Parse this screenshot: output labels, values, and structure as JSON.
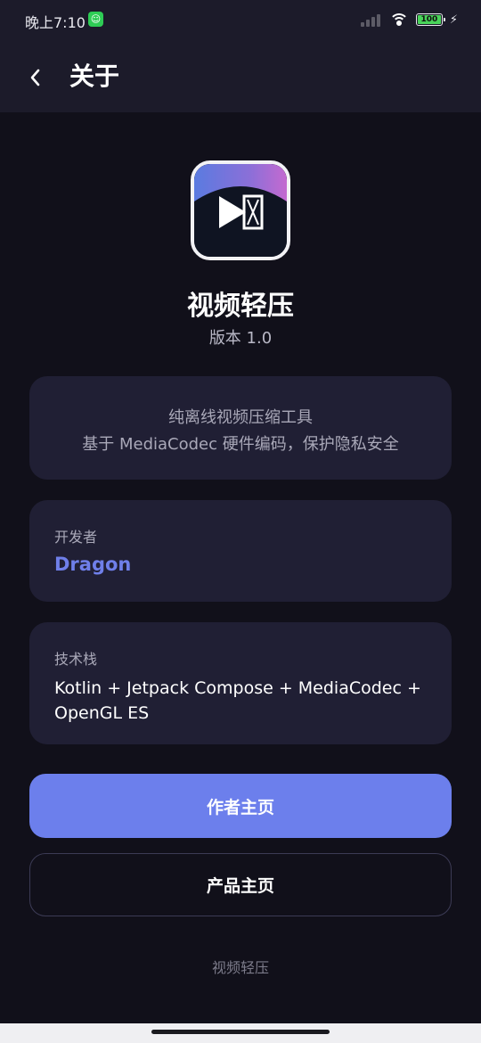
{
  "status_bar": {
    "time": "晚上7:10",
    "battery_level": "100",
    "icons": [
      "app-notification-icon",
      "signal-icon",
      "wifi-icon",
      "battery-icon",
      "charging-icon"
    ]
  },
  "header": {
    "back_icon": "chevron-left-icon",
    "title": "关于"
  },
  "app": {
    "icon": "app-logo-icon",
    "name": "视频轻压",
    "version": "版本 1.0"
  },
  "description": {
    "line1": "纯离线视频压缩工具",
    "line2": "基于 MediaCodec 硬件编码，保护隐私安全"
  },
  "developer": {
    "label": "开发者",
    "name": "Dragon"
  },
  "tech_stack": {
    "label": "技术栈",
    "line1": "Kotlin + Jetpack Compose + MediaCodec +",
    "line2": "OpenGL ES"
  },
  "buttons": {
    "author_home": "作者主页",
    "product_home": "产品主页"
  },
  "footer": {
    "text": "视频轻压"
  },
  "colors": {
    "background": "#11101a",
    "header_background": "#1c1b2a",
    "card_background": "#201f34",
    "accent": "#6c7fec",
    "developer_name": "#6f7fe9"
  }
}
